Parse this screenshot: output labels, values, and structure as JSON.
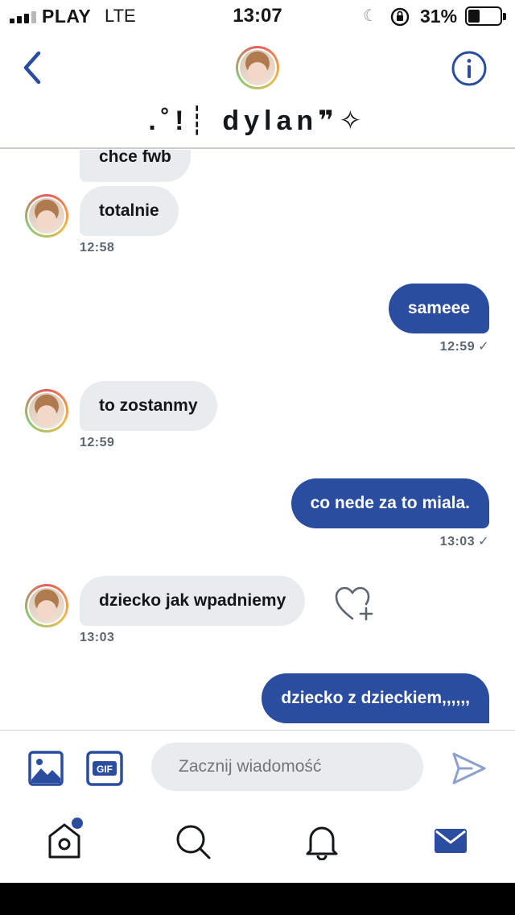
{
  "status": {
    "carrier": "PLAY",
    "network": "LTE",
    "time": "13:07",
    "battery": "31%"
  },
  "header": {
    "title": ".˚!┊ dylan❞✧"
  },
  "messages": [
    {
      "dir": "in",
      "text": "chce fwb"
    },
    {
      "dir": "in",
      "text": "totalnie",
      "time": "12:58"
    },
    {
      "dir": "out",
      "text": "sameee",
      "time": "12:59"
    },
    {
      "dir": "in",
      "text": "to zostanmy",
      "time": "12:59"
    },
    {
      "dir": "out",
      "text": "co nede za to miala.",
      "time": "13:03"
    },
    {
      "dir": "in",
      "text": "dziecko jak wpadniemy",
      "time": "13:03"
    },
    {
      "dir": "out",
      "text": "dziecko z dzieckiem,,,,,,"
    }
  ],
  "composer": {
    "placeholder": "Zacznij wiadomość",
    "gif_label": "GIF"
  },
  "icons": {
    "back": "chevron-left-icon",
    "info": "info-icon",
    "image": "image-icon",
    "gif": "gif-icon",
    "send": "send-icon",
    "home": "home-icon",
    "search": "search-icon",
    "notifications": "bell-icon",
    "messages": "mail-icon",
    "like": "heart-plus-icon"
  },
  "colors": {
    "accent": "#2a4da0",
    "incoming_bubble": "#e9ecef",
    "timestamp": "#5b6670"
  }
}
